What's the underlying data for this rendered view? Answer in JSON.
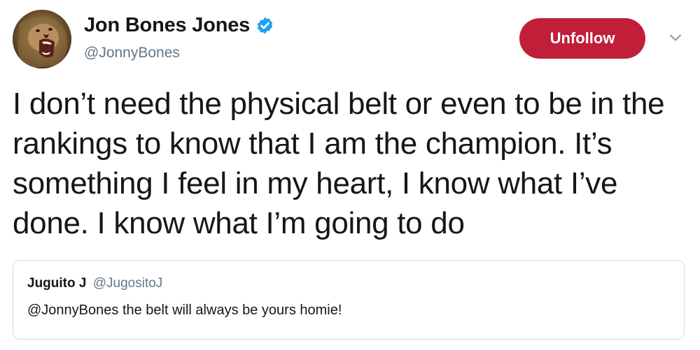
{
  "author": {
    "display_name": "Jon Bones Jones",
    "handle": "@JonnyBones",
    "verified": true,
    "avatar_icon": "lion-roaring-avatar"
  },
  "actions": {
    "follow_button_label": "Unfollow",
    "menu_icon": "chevron-down-icon"
  },
  "tweet": {
    "text": "I don’t need the physical belt or even to be in the rankings to know that I am the champion. It’s something I feel in my heart, I know what I’ve done. I know what I’m going to do"
  },
  "quoted_tweet": {
    "display_name": "Juguito J",
    "handle": "@JugositoJ",
    "text": "@JonnyBones the belt will always be yours homie!"
  },
  "colors": {
    "unfollow_button": "#c11e39",
    "verified_badge": "#1da1f2",
    "secondary_text": "#657786",
    "quote_border": "#cfd9de"
  }
}
